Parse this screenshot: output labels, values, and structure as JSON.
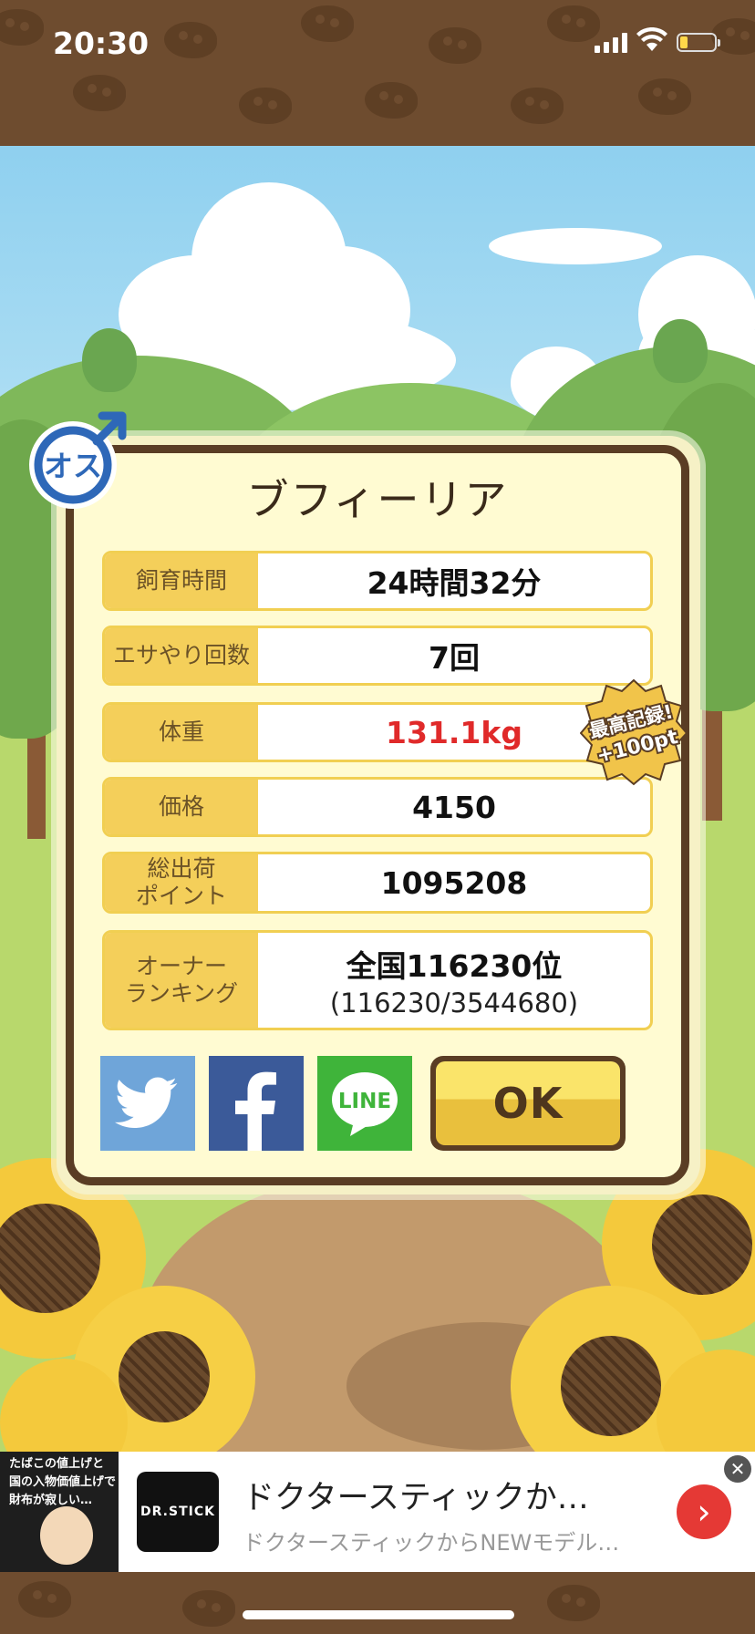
{
  "status_bar": {
    "time": "20:30"
  },
  "dialog": {
    "gender_label": "オス",
    "title": "ブフィーリア",
    "rows": [
      {
        "label": "飼育時間",
        "value": "24時間32分"
      },
      {
        "label": "エサやり回数",
        "value": "7回"
      },
      {
        "label": "体重",
        "value": "131.1kg",
        "highlight": "#e02a2a"
      },
      {
        "label": "価格",
        "value": "4150"
      },
      {
        "label": "総出荷\nポイント",
        "value": "1095208"
      },
      {
        "label": "オーナー\nランキング",
        "value": "全国116230位",
        "sub": "(116230/3544680)"
      }
    ],
    "record_badge": {
      "line1": "最高記録!",
      "line2": "+100pt"
    },
    "share_buttons": [
      "twitter-icon",
      "facebook-icon",
      "line-icon"
    ],
    "line_label": "LINE",
    "ok_label": "OK"
  },
  "ad": {
    "thumb_text": "たばこの値上げと\n国の入物価値上げで\n財布が寂しい…",
    "logo": "DR.STICK",
    "title": "ドクタースティックか…",
    "subtitle": "ドクタースティックからNEWモデル…",
    "arrow": "›",
    "close": "✕"
  },
  "colors": {
    "accent_yellow": "#f4cf5a",
    "border_brown": "#5a3d24",
    "record_red": "#e02a2a"
  }
}
